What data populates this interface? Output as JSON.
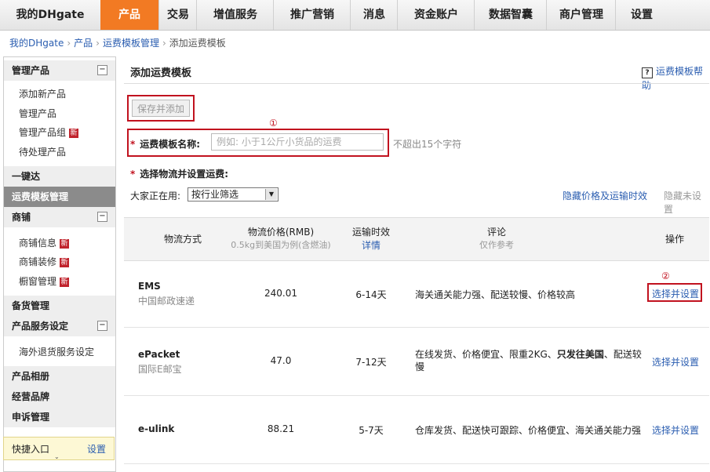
{
  "nav": {
    "brand": "我的DHgate",
    "tabs": [
      "产品",
      "交易",
      "增值服务",
      "推广营销",
      "消息",
      "资金账户",
      "数据智囊",
      "商户管理",
      "设置"
    ],
    "accent": "#f27a23"
  },
  "breadcrumb": [
    "我的DHgate",
    "产品",
    "运费模板管理",
    "添加运费模板"
  ],
  "sidebar": {
    "section1": {
      "title": "管理产品",
      "items": [
        "添加新产品",
        "管理产品",
        "管理产品组",
        "待处理产品"
      ]
    },
    "yijianda": "一键达",
    "active": "运费模板管理",
    "section2": {
      "title": "商铺",
      "items": [
        "商铺信息",
        "商铺装修",
        "橱窗管理"
      ]
    },
    "beihuo": "备货管理",
    "section3": {
      "title": "产品服务设定",
      "items": [
        "海外退货服务设定"
      ]
    },
    "more": [
      "产品相册",
      "经营品牌",
      "申诉管理"
    ],
    "new_badge": "新",
    "quick": {
      "title": "快捷入口",
      "settings": "设置"
    }
  },
  "main": {
    "title": "添加运费模板",
    "help": "运费模板帮助",
    "save_button": "保存并添加",
    "mark1": "①",
    "mark2": "②",
    "name_label": "运费模板名称:",
    "name_placeholder": "例如: 小于1公斤小货品的运费",
    "name_hint": "不超出15个字符",
    "logistics_label": "选择物流并设置运费:",
    "filter_label": "大家正在用:",
    "filter_value": "按行业筛选",
    "hide_price_link": "隐藏价格及运输时效",
    "hide_unset": "隐藏未设置"
  },
  "table": {
    "headers": {
      "method": "物流方式",
      "price": "物流价格(RMB)",
      "price_sub": "0.5kg到美国为例(含燃油)",
      "time": "运输时效",
      "time_sub": "详情",
      "comment": "评论",
      "comment_sub": "仅作参考",
      "action": "操作"
    },
    "rows": [
      {
        "name": "EMS",
        "sub": "中国邮政速递",
        "price": "240.01",
        "time": "6-14天",
        "comment": "海关通关能力强、配送较慢、价格较高",
        "action": "选择并设置"
      },
      {
        "name": "ePacket",
        "sub": "国际E邮宝",
        "price": "47.0",
        "time": "7-12天",
        "comment": "在线发货、价格便宜、限重2KG、",
        "comment_bold": "只发往美国",
        "comment_tail": "、配送较慢",
        "action": "选择并设置"
      },
      {
        "name": "e-ulink",
        "sub": "",
        "price": "88.21",
        "time": "5-7天",
        "comment": "仓库发货、配送快可跟踪、价格便宜、海关通关能力强",
        "action": "选择并设置"
      }
    ]
  }
}
